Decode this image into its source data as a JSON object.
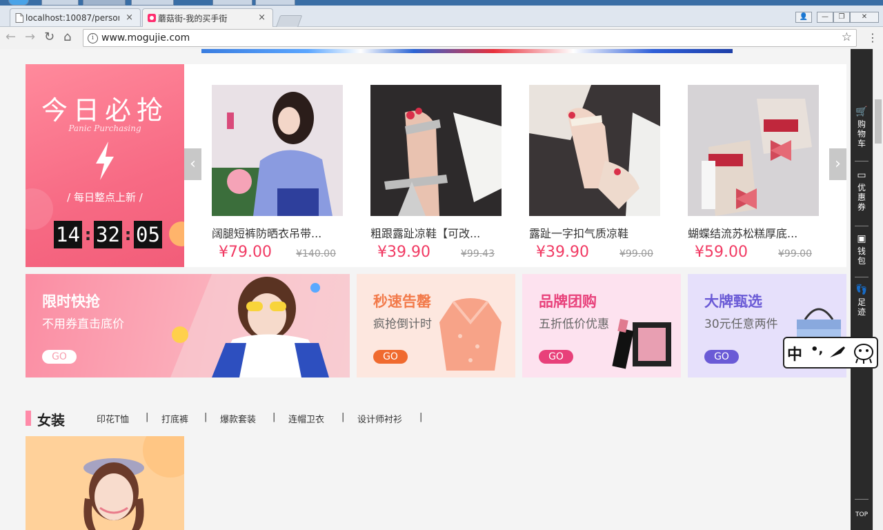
{
  "browser": {
    "tabs": [
      {
        "label": "localhost:10087/persor",
        "close": "×"
      },
      {
        "label": "蘑菇街-我的买手街",
        "close": "×"
      }
    ],
    "url": "www.mogujie.com",
    "nav": {
      "back": "←",
      "forward": "→",
      "reload": "↻",
      "home": "⌂"
    },
    "window": {
      "user": "👤",
      "minimize": "—",
      "restore": "❐",
      "close": "✕"
    }
  },
  "flash_sale": {
    "title": "今日必抢",
    "subtitle": "Panic Purchasing",
    "note": "/  每日整点上新  /",
    "countdown": {
      "hours": "14",
      "minutes": "32",
      "seconds": "05",
      "separator": ":"
    },
    "arrow_left": "‹",
    "arrow_right": "›",
    "products": [
      {
        "name": "阔腿短裤防晒衣吊带...",
        "price": "¥79.00",
        "original_price": "¥140.00"
      },
      {
        "name": "粗跟露趾凉鞋【可改...",
        "price": "¥39.90",
        "original_price": "¥99.43"
      },
      {
        "name": "露趾一字扣气质凉鞋",
        "price": "¥39.90",
        "original_price": "¥99.00"
      },
      {
        "name": "蝴蝶结流苏松糕厚底...",
        "price": "¥59.00",
        "original_price": "¥99.00"
      }
    ]
  },
  "promos": [
    {
      "title": "限时快抢",
      "subtitle": "不用券直击底价",
      "button": "GO"
    },
    {
      "title": "秒速告罄",
      "subtitle": "疯抢倒计时",
      "button": "GO"
    },
    {
      "title": "品牌团购",
      "subtitle": "五折低价优惠",
      "button": "GO"
    },
    {
      "title": "大牌甄选",
      "subtitle": "30元任意两件",
      "button": "GO"
    }
  ],
  "category": {
    "title": "女装",
    "links": [
      "印花T恤",
      "打底裤",
      "爆款套装",
      "连帽卫衣",
      "设计师衬衫"
    ],
    "separator": "|"
  },
  "sidebar": {
    "items": [
      {
        "label": "购物车",
        "icon": "cart-icon"
      },
      {
        "label": "优惠券",
        "icon": "coupon-icon"
      },
      {
        "label": "钱包",
        "icon": "wallet-icon"
      },
      {
        "label": "足迹",
        "icon": "footprint-icon"
      }
    ],
    "top": "TOP"
  },
  "ime": {
    "mode": "中",
    "punct": "•,"
  },
  "colors": {
    "accent": "#f13a63",
    "sidebar": "#2a2a2a"
  }
}
